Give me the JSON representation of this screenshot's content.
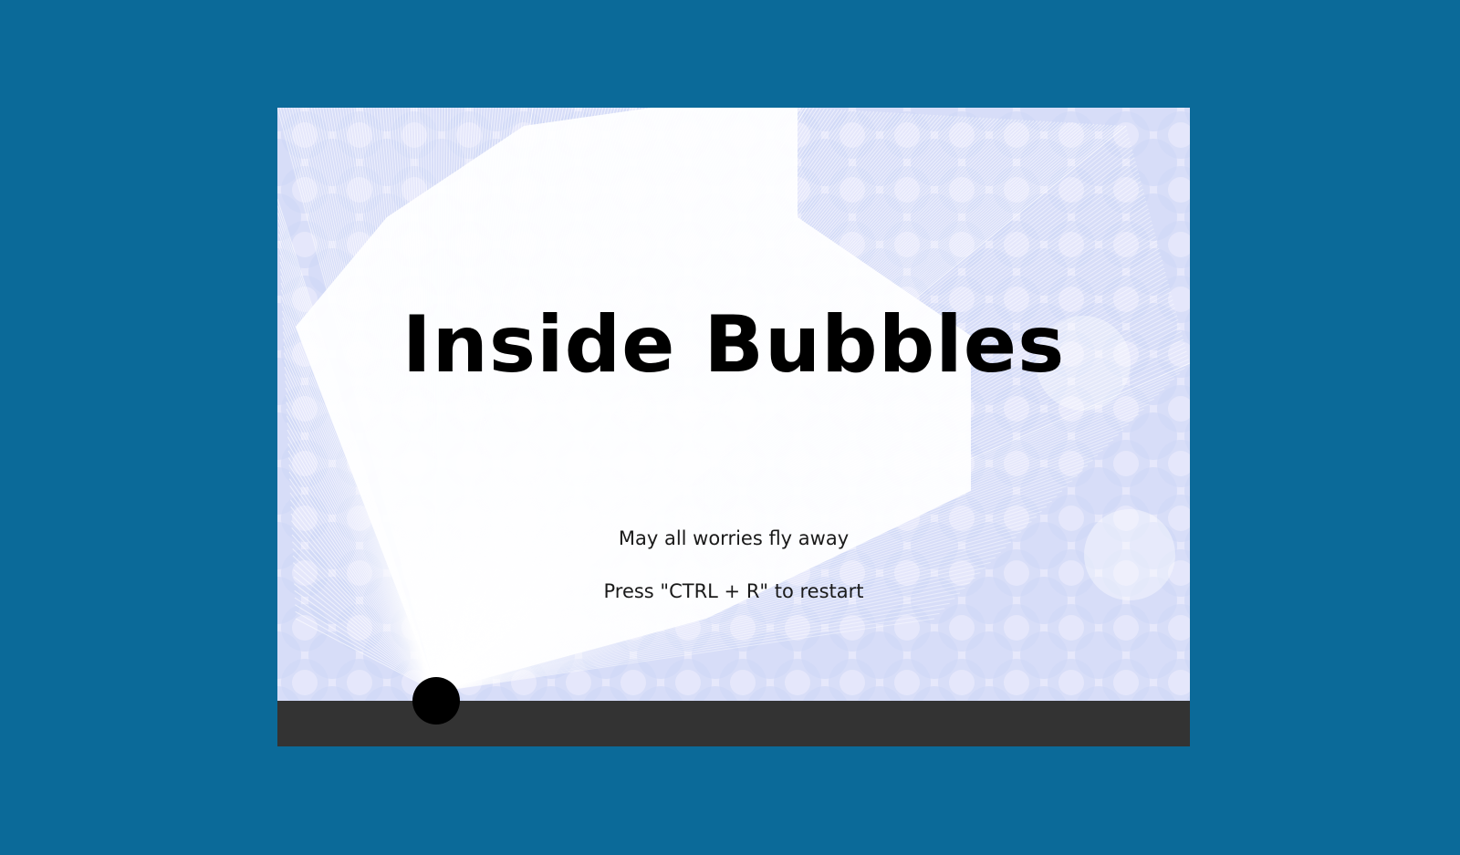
{
  "game": {
    "title": "Inside Bubbles",
    "subtitle": "May all worries fly away",
    "restart_hint": "Press \"CTRL + R\" to restart"
  },
  "colors": {
    "page_background": "#0b6a99",
    "canvas_background": "#e6e8fb",
    "bubble_pattern": "#c9d4f6",
    "light_rays": "#ffffff",
    "ground": "#333333",
    "player": "#000000"
  }
}
